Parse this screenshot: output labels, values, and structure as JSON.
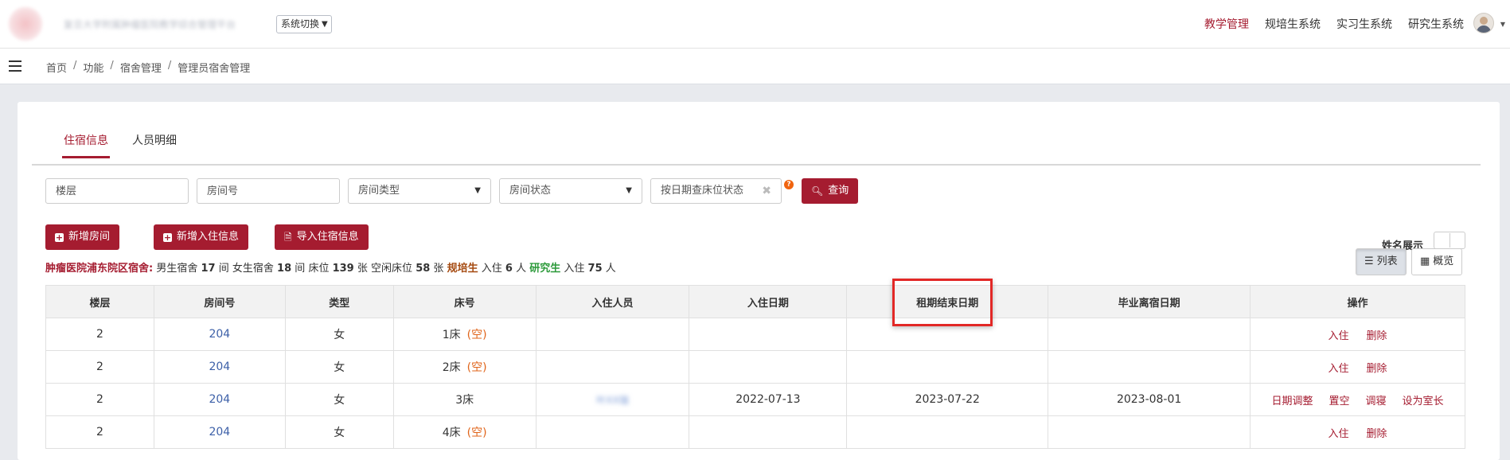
{
  "header": {
    "system_title": "复旦大学附属肿瘤医院教学综合管理平台",
    "switch_label": "系统切换",
    "nav": [
      "教学管理",
      "规培生系统",
      "实习生系统",
      "研究生系统"
    ]
  },
  "breadcrumb": [
    "首页",
    "功能",
    "宿舍管理",
    "管理员宿舍管理"
  ],
  "tabs": [
    "住宿信息",
    "人员明细"
  ],
  "filters": {
    "floor_placeholder": "楼层",
    "room_placeholder": "房间号",
    "room_type": "房间类型",
    "room_status": "房间状态",
    "date_placeholder": "按日期查床位状态",
    "search_label": "查询"
  },
  "actions": {
    "add_room": "新增房间",
    "add_checkin": "新增入住信息",
    "import_checkin": "导入住宿信息"
  },
  "summary": {
    "org": "肿瘤医院浦东院区宿舍:",
    "male_label": "男生宿舍",
    "male_count": "17",
    "room_unit": "间",
    "female_label": "女生宿舍",
    "female_count": "18",
    "bed_label": "床位",
    "bed_count": "139",
    "bed_unit": "张",
    "free_label": "空闲床位",
    "free_count": "58",
    "resident_label": "规培生",
    "checkin_label": "入住",
    "resident_count": "6",
    "person_unit": "人",
    "grad_label": "研究生",
    "grad_count": "75"
  },
  "toggle": {
    "label": "姓名展示"
  },
  "views": {
    "list": "列表",
    "overview": "概览"
  },
  "table": {
    "headers": [
      "楼层",
      "房间号",
      "类型",
      "床号",
      "入住人员",
      "入住日期",
      "租期结束日期",
      "毕业离宿日期",
      "操作"
    ],
    "rows": [
      {
        "floor": "2",
        "room": "204",
        "type": "女",
        "bed": "1床",
        "empty": "(空)",
        "person": "",
        "checkin": "",
        "lease_end": "",
        "grad_leave": "",
        "ops": [
          "入住",
          "删除"
        ]
      },
      {
        "floor": "2",
        "room": "204",
        "type": "女",
        "bed": "2床",
        "empty": "(空)",
        "person": "",
        "checkin": "",
        "lease_end": "",
        "grad_leave": "",
        "ops": [
          "入住",
          "删除"
        ]
      },
      {
        "floor": "2",
        "room": "204",
        "type": "女",
        "bed": "3床",
        "empty": "",
        "person": "叶XX瑞",
        "checkin": "2022-07-13",
        "lease_end": "2023-07-22",
        "grad_leave": "2023-08-01",
        "ops": [
          "日期调整",
          "置空",
          "调寝",
          "设为室长"
        ]
      },
      {
        "floor": "2",
        "room": "204",
        "type": "女",
        "bed": "4床",
        "empty": "(空)",
        "person": "",
        "checkin": "",
        "lease_end": "",
        "grad_leave": "",
        "ops": [
          "入住",
          "删除"
        ]
      }
    ]
  },
  "colors": {
    "brand": "#a51c30",
    "link": "#3d60a8",
    "empty": "#e0641a",
    "highlight": "#e22826"
  }
}
